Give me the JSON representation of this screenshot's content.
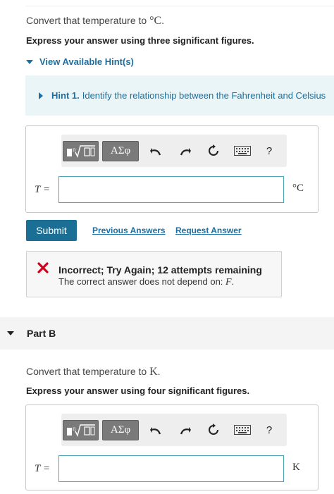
{
  "part_a": {
    "prompt_text": "Convert that temperature to ",
    "prompt_unit": "°C",
    "prompt_end": ".",
    "instruction": "Express your answer using three significant figures.",
    "hints_toggle_label": "View Available Hint(s)",
    "hint1_title": "Hint 1.",
    "hint1_text": "Identify the relationship between the Fahrenheit and Celsius",
    "variable_label": "T =",
    "input_value": "",
    "unit_label": "°C",
    "submit_label": "Submit",
    "previous_answers_label": "Previous Answers",
    "request_answer_label": "Request Answer",
    "feedback_title": "Incorrect; Try Again; 12 attempts remaining",
    "feedback_message": "The correct answer does not depend on: ",
    "feedback_variable": "F",
    "feedback_end": "."
  },
  "toolbar": {
    "greek_label": "ΑΣφ",
    "help_label": "?",
    "icons": [
      "templates-icon",
      "greek-letters-icon",
      "undo-icon",
      "redo-icon",
      "reset-icon",
      "keyboard-icon",
      "help-icon"
    ]
  },
  "part_b": {
    "section_label": "Part B",
    "prompt_text": "Convert that temperature to ",
    "prompt_unit": "K",
    "prompt_end": ".",
    "instruction": "Express your answer using four significant figures.",
    "variable_label": "T =",
    "input_value": "",
    "unit_label": "K"
  },
  "colors": {
    "accent": "#1b6fa2",
    "submit_bg": "#1c6f94",
    "hint_bg": "#e9f5f6",
    "error_red": "#d0021b"
  }
}
